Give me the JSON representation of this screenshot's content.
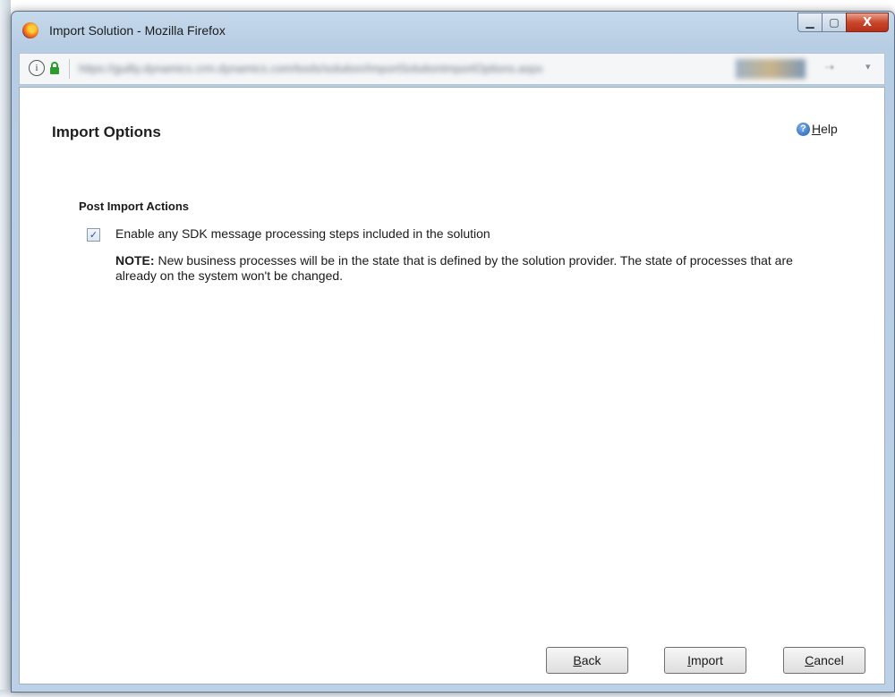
{
  "window": {
    "title": "Import Solution - Mozilla Firefox",
    "controls": {
      "minimize": "▁",
      "maximize": "▢",
      "close": "X"
    }
  },
  "urlbar": {
    "info_glyph": "i",
    "lock_glyph": "🔒",
    "url": "https://guilty.dynamics.crm.dynamics.com/tools/solution/ImportSolutionImportOptions.aspx"
  },
  "page": {
    "heading": "Import Options",
    "help": {
      "accel": "H",
      "rest": "elp"
    },
    "section_title": "Post Import Actions",
    "checkbox": {
      "checked": true,
      "glyph": "✓",
      "label": "Enable any SDK message processing steps included in the solution"
    },
    "note": {
      "prefix": "NOTE:",
      "text": " New business processes will be in the state that is defined by the solution provider. The state of processes that are already on the system won't be changed."
    }
  },
  "buttons": {
    "back": {
      "accel": "B",
      "rest": "ack"
    },
    "import": {
      "accel": "I",
      "rest": "mport"
    },
    "cancel": {
      "accel": "C",
      "rest": "ancel"
    }
  },
  "colors": {
    "title_bar": "#bcd1e6",
    "close_button": "#c9472a",
    "help_icon": "#1d5bb3",
    "checkbox_mark": "#2356a8"
  }
}
